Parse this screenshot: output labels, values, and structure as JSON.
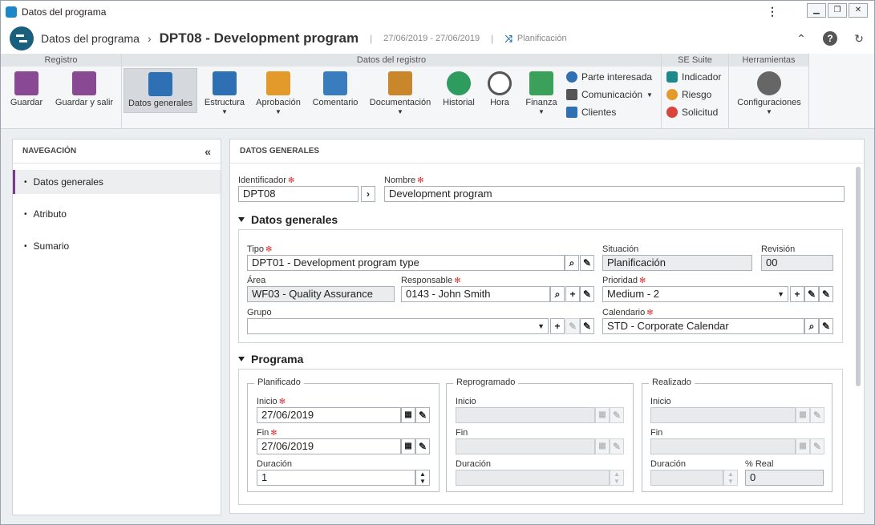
{
  "window": {
    "title": "Datos del programa",
    "controls": [
      "minimize-icon",
      "restore-icon",
      "close-icon"
    ]
  },
  "header": {
    "crumb": "Datos del programa",
    "record": "DPT08 - Development program",
    "dates": "27/06/2019 - 27/06/2019",
    "status_label": "Planificación"
  },
  "ribbon": {
    "groups": {
      "registro": "Registro",
      "datos": "Datos del registro",
      "suite": "SE Suite",
      "herr": "Herramientas"
    },
    "buttons": {
      "guardar": "Guardar",
      "guardar_salir": "Guardar y salir",
      "datos_generales": "Datos generales",
      "estructura": "Estructura",
      "aprobacion": "Aprobación",
      "comentario": "Comentario",
      "documentacion": "Documentación",
      "historial": "Historial",
      "hora": "Hora",
      "finanza": "Finanza",
      "parte_interesada": "Parte interesada",
      "comunicacion": "Comunicación",
      "clientes": "Clientes",
      "indicador": "Indicador",
      "riesgo": "Riesgo",
      "solicitud": "Solicitud",
      "configuraciones": "Configuraciones"
    },
    "colors": {
      "purple": "#7c3b86",
      "blue": "#1e6fb5",
      "green": "#2e9b5f",
      "orange": "#e49a2a",
      "red": "#d8453a",
      "teal": "#1b8a8a"
    }
  },
  "nav": {
    "title": "NAVEGACIÓN",
    "items": [
      {
        "label": "Datos generales",
        "active": true
      },
      {
        "label": "Atributo",
        "active": false
      },
      {
        "label": "Sumario",
        "active": false
      }
    ]
  },
  "main": {
    "title": "DATOS GENERALES",
    "identificador": {
      "label": "Identificador",
      "value": "DPT08"
    },
    "nombre": {
      "label": "Nombre",
      "value": "Development program"
    },
    "section1": "Datos generales",
    "tipo": {
      "label": "Tipo",
      "value": "DPT01 - Development program type"
    },
    "situacion": {
      "label": "Situación",
      "value": "Planificación"
    },
    "revision": {
      "label": "Revisión",
      "value": "00"
    },
    "area": {
      "label": "Área",
      "value": "WF03 - Quality Assurance"
    },
    "responsable": {
      "label": "Responsable",
      "value": "0143 - John Smith"
    },
    "prioridad": {
      "label": "Prioridad",
      "value": "Medium - 2"
    },
    "grupo": {
      "label": "Grupo",
      "value": ""
    },
    "calendario": {
      "label": "Calendario",
      "value": "STD - Corporate Calendar"
    },
    "section2": "Programa",
    "planificado": {
      "title": "Planificado",
      "inicio_label": "Inicio",
      "inicio": "27/06/2019",
      "fin_label": "Fin",
      "fin": "27/06/2019",
      "duracion_label": "Duración",
      "duracion": "1"
    },
    "reprogramado": {
      "title": "Reprogramado",
      "inicio_label": "Inicio",
      "inicio": "",
      "fin_label": "Fin",
      "fin": "",
      "duracion_label": "Duración",
      "duracion": ""
    },
    "realizado": {
      "title": "Realizado",
      "inicio_label": "Inicio",
      "inicio": "",
      "fin_label": "Fin",
      "fin": "",
      "duracion_label": "Duración",
      "duracion": "",
      "real_label": "% Real",
      "real": "0"
    }
  }
}
